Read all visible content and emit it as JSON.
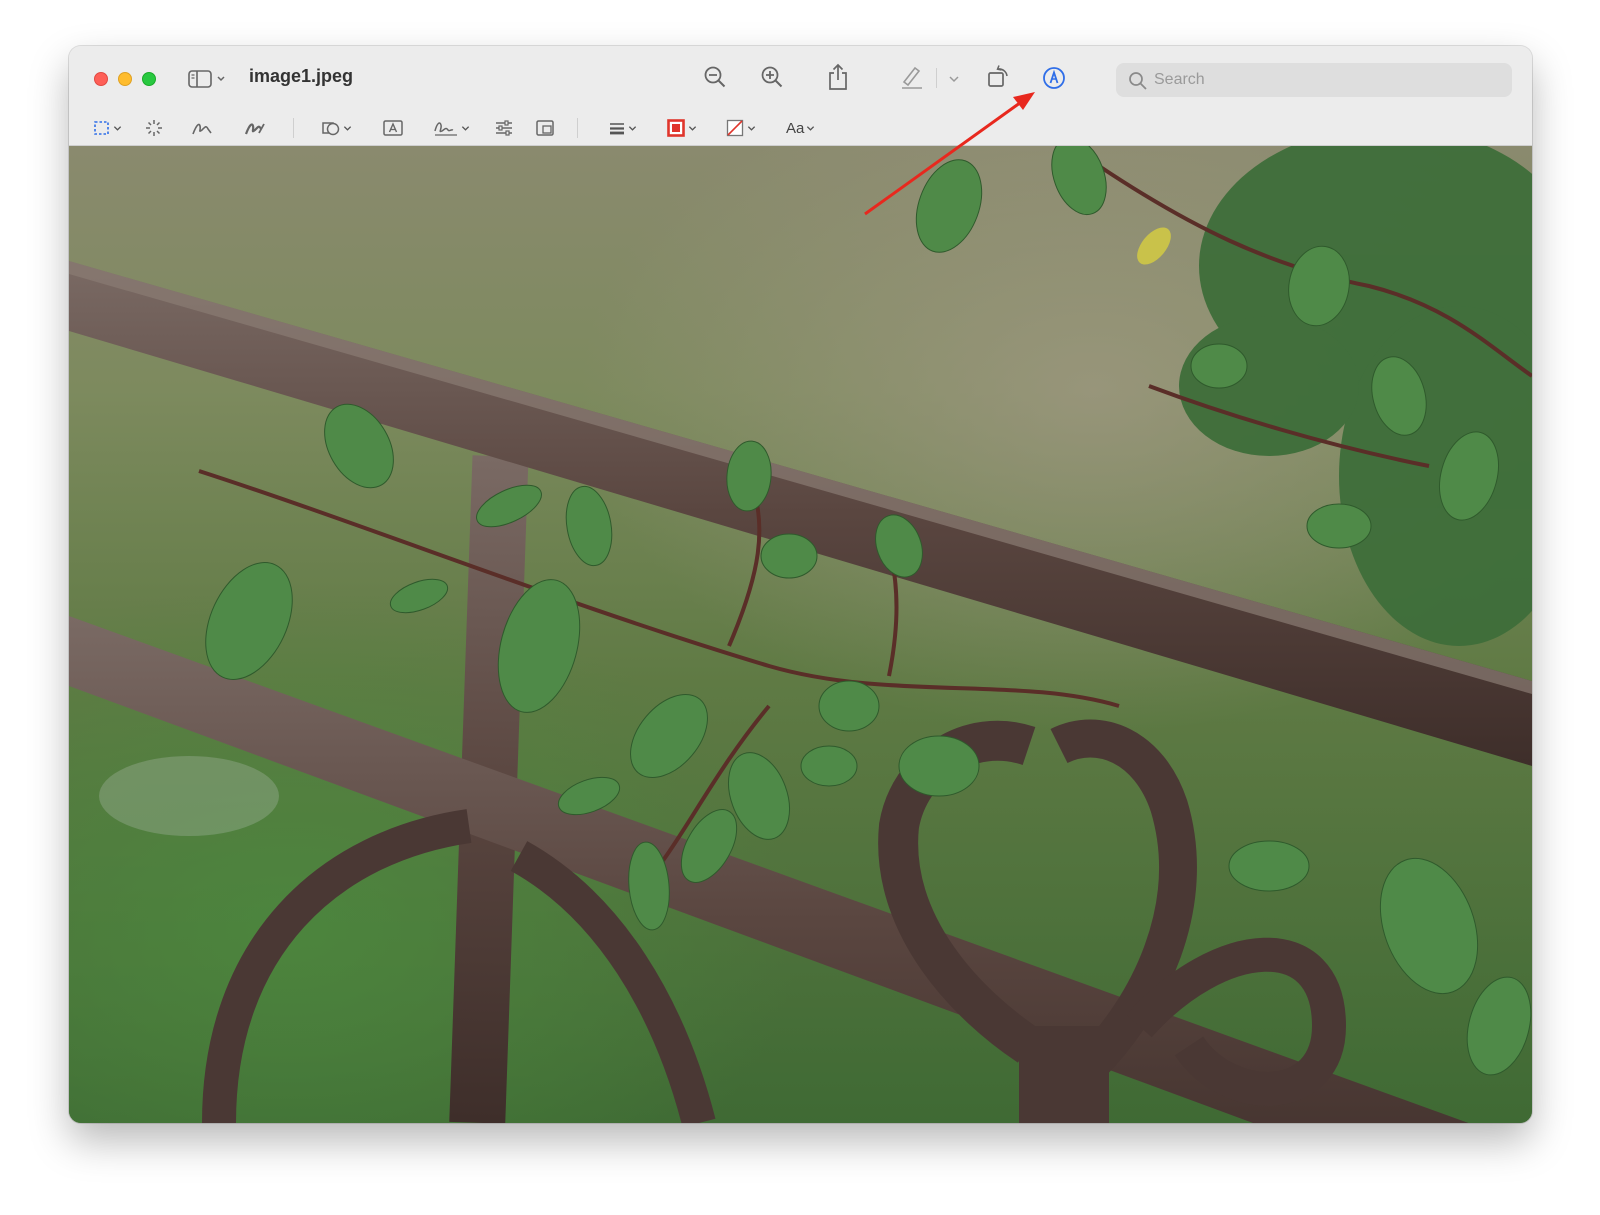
{
  "window": {
    "title": "image1.jpeg",
    "traffic_lights": [
      "close",
      "minimize",
      "zoom"
    ]
  },
  "toolbar": {
    "icons": [
      "sidebar-toggle-icon",
      "zoom-out-icon",
      "zoom-in-icon",
      "share-icon",
      "highlight-pen-icon",
      "rotate-icon",
      "markup-icon"
    ],
    "search": {
      "placeholder": "Search"
    }
  },
  "markup_toolbar": {
    "tools": [
      "rectangular-selection",
      "instant-alpha",
      "sketch",
      "draw",
      "shapes",
      "text-box",
      "sign",
      "adjust-color",
      "adjust-size",
      "shape-style",
      "border-color",
      "fill-color",
      "text-style"
    ],
    "text_style_label": "Aa",
    "border_color": "#e0352b",
    "fill_color": "none"
  },
  "annotation": {
    "type": "arrow",
    "color": "#e8281e",
    "points_to": "markup-icon"
  },
  "image": {
    "subject": "rusty iron fence with green leafy branches"
  }
}
